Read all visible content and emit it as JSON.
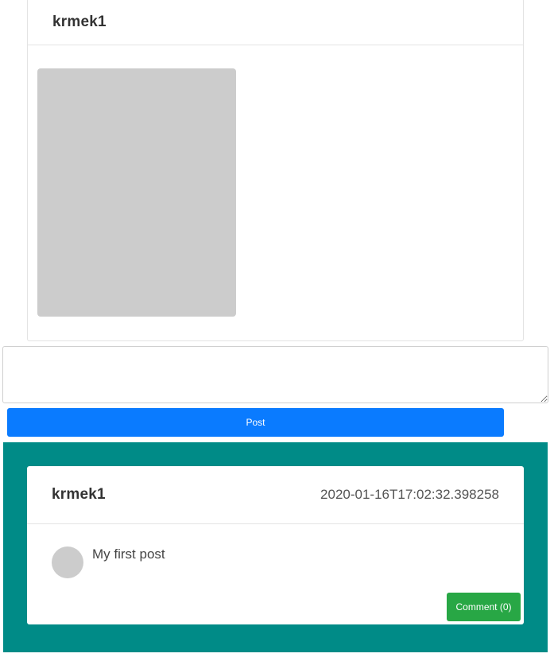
{
  "profile": {
    "username": "krmek1"
  },
  "composer": {
    "value": "",
    "post_label": "Post"
  },
  "feed": {
    "posts": [
      {
        "username": "krmek1",
        "timestamp": "2020-01-16T17:02:32.398258",
        "text": "My first post",
        "comment_label": "Comment (0)"
      }
    ]
  },
  "colors": {
    "primary": "#0a7bff",
    "success": "#28a745",
    "feed_background": "#008b87",
    "placeholder_gray": "#cccccc"
  }
}
